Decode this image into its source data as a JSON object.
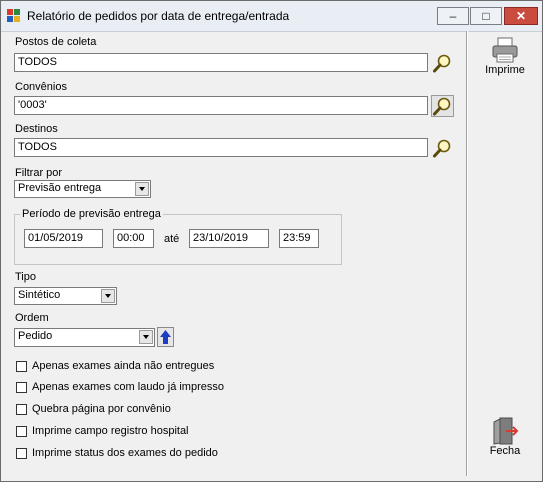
{
  "window": {
    "title": "Relatório de pedidos por data de entrega/entrada",
    "controls": {
      "minimize": "–",
      "maximize": "□",
      "close": "✕"
    }
  },
  "filters": {
    "postos": {
      "label": "Postos de coleta",
      "value": "TODOS"
    },
    "convenios": {
      "label": "Convênios",
      "value": "'0003'"
    },
    "destinos": {
      "label": "Destinos",
      "value": "TODOS"
    },
    "filtrar_por": {
      "label": "Filtrar por",
      "value": "Previsão entrega"
    }
  },
  "periodo": {
    "title": "Período de previsão entrega",
    "start_date": "01/05/2019",
    "start_time": "00:00",
    "connector": "até",
    "end_date": "23/10/2019",
    "end_time": "23:59"
  },
  "tipo": {
    "label": "Tipo",
    "value": "Sintético"
  },
  "ordem": {
    "label": "Ordem",
    "value": "Pedido"
  },
  "options": [
    {
      "label": "Apenas exames ainda não entregues",
      "checked": false
    },
    {
      "label": "Apenas exames com laudo já impresso",
      "checked": false
    },
    {
      "label": "Quebra página por convênio",
      "checked": false
    },
    {
      "label": "Imprime campo registro hospital",
      "checked": false
    },
    {
      "label": "Imprime status dos exames do pedido",
      "checked": false
    }
  ],
  "side": {
    "print_label": "Imprime",
    "close_label": "Fecha"
  },
  "colors": {
    "titlebar": "#e9eef4",
    "close_button": "#c94c3e",
    "window_bg": "#f0f0f0",
    "sort_arrow": "#1c3fbf"
  }
}
